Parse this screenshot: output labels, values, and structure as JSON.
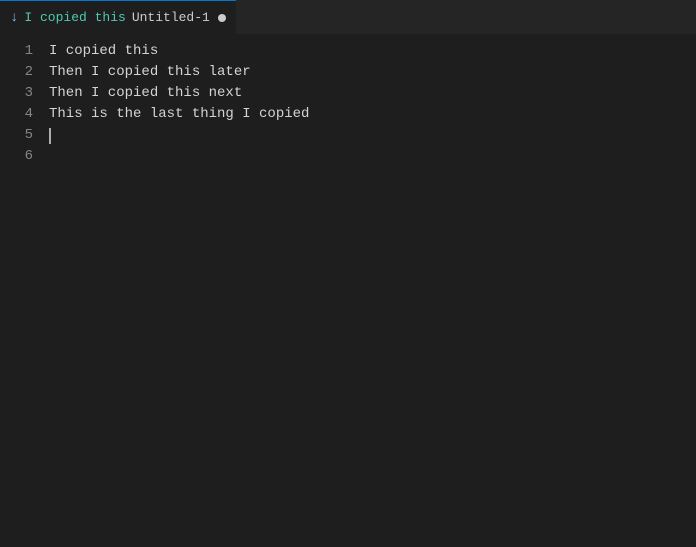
{
  "tab": {
    "icon": "↓",
    "active_text": "I copied this",
    "filename": "Untitled-1",
    "modified": true
  },
  "editor": {
    "lines": [
      {
        "number": "1",
        "content": "I copied this"
      },
      {
        "number": "2",
        "content": "Then I copied this later"
      },
      {
        "number": "3",
        "content": "Then I copied this next"
      },
      {
        "number": "4",
        "content": "This is the last thing I copied"
      },
      {
        "number": "5",
        "content": ""
      },
      {
        "number": "6",
        "content": ""
      }
    ]
  }
}
